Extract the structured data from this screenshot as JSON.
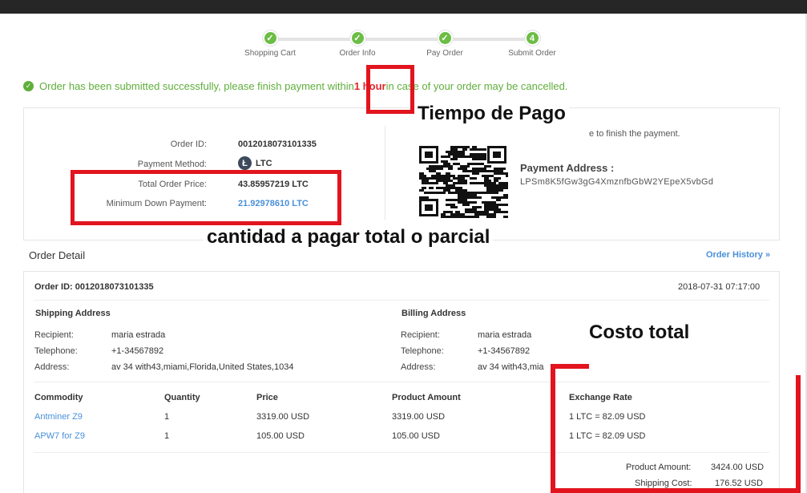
{
  "steps": [
    {
      "label": "Shopping Cart",
      "mark": "✓"
    },
    {
      "label": "Order Info",
      "mark": "✓"
    },
    {
      "label": "Pay Order",
      "mark": "✓"
    },
    {
      "label": "Submit Order",
      "mark": "4"
    }
  ],
  "notice": {
    "before": "Order has been submitted successfully, please finish payment within ",
    "time": "1 hour",
    "after": " in case of your order may be cancelled."
  },
  "summary": {
    "order_id_label": "Order ID:",
    "order_id": "0012018073101335",
    "payment_method_label": "Payment Method:",
    "payment_method": "LTC",
    "total_label": "Total Order Price:",
    "total": "43.85957219 LTC",
    "min_label": "Minimum Down Payment:",
    "min": "21.92978610 LTC"
  },
  "payment": {
    "hint": "e to finish the payment.",
    "address_label": "Payment Address :",
    "address": "LPSm8K5fGw3gG4XmznfbGbW2YEpeX5vbGd"
  },
  "order_detail": {
    "title": "Order Detail",
    "history": "Order History",
    "order_id_line": "Order ID: 0012018073101335",
    "datetime": "2018-07-31 07:17:00",
    "shipping": {
      "title": "Shipping Address",
      "recipient_label": "Recipient:",
      "recipient": "maria estrada",
      "phone_label": "Telephone:",
      "phone": "+1-34567892",
      "address_label": "Address:",
      "address": "av 34 with43,miami,Florida,United States,1034"
    },
    "billing": {
      "title": "Billing Address",
      "recipient_label": "Recipient:",
      "recipient": "maria estrada",
      "phone_label": "Telephone:",
      "phone": "+1-34567892",
      "address_label": "Address:",
      "address": "av 34 with43,mia"
    },
    "columns": [
      "Commodity",
      "Quantity",
      "Price",
      "Product Amount",
      "Exchange Rate"
    ],
    "rows": [
      {
        "name": "Antminer Z9",
        "qty": "1",
        "price": "3319.00 USD",
        "amount": "3319.00 USD",
        "rate": "1 LTC = 82.09 USD"
      },
      {
        "name": "APW7 for Z9",
        "qty": "1",
        "price": "105.00 USD",
        "amount": "105.00 USD",
        "rate": "1 LTC = 82.09 USD"
      }
    ],
    "totals": {
      "product_label": "Product Amount:",
      "product": "3424.00 USD",
      "shipping_label": "Shipping Cost:",
      "shipping": "176.52 USD"
    }
  },
  "annotations": {
    "pay_time": "Tiempo de Pago",
    "amount": "cantidad a pagar total o parcial",
    "total_cost": "Costo total"
  },
  "colors": {
    "accent_green": "#6cbd45",
    "link_blue": "#4a90d9",
    "annotation_red": "#e2141e"
  }
}
